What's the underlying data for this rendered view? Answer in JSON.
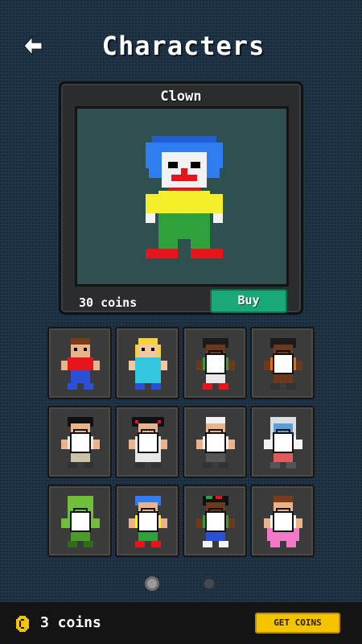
{
  "header": {
    "title": "Characters",
    "back_icon": "back-arrow-icon"
  },
  "preview": {
    "name": "Clown",
    "price": "30 coins",
    "buy_label": "Buy"
  },
  "characters": [
    {
      "id": "boy-red-shirt",
      "locked": false
    },
    {
      "id": "blonde-girl",
      "locked": false
    },
    {
      "id": "afro-green-locked",
      "locked": true
    },
    {
      "id": "afro-orange-locked",
      "locked": true
    },
    {
      "id": "black-hair-white-locked",
      "locked": true
    },
    {
      "id": "pigtails-girl-locked",
      "locked": true
    },
    {
      "id": "chef-locked",
      "locked": true
    },
    {
      "id": "helmet-astronaut-locked",
      "locked": true
    },
    {
      "id": "green-alien-locked",
      "locked": true
    },
    {
      "id": "blue-hair-locked",
      "locked": true
    },
    {
      "id": "rasta-locked",
      "locked": true
    },
    {
      "id": "pink-dress-girl-locked",
      "locked": true
    }
  ],
  "pagination": {
    "pages": 2,
    "current": 1
  },
  "footer": {
    "coins": "3 coins",
    "get_coins_label": "GET COINS"
  },
  "colors": {
    "background": "#1f3547",
    "buy": "#19a877",
    "get_coins": "#f5c400"
  }
}
